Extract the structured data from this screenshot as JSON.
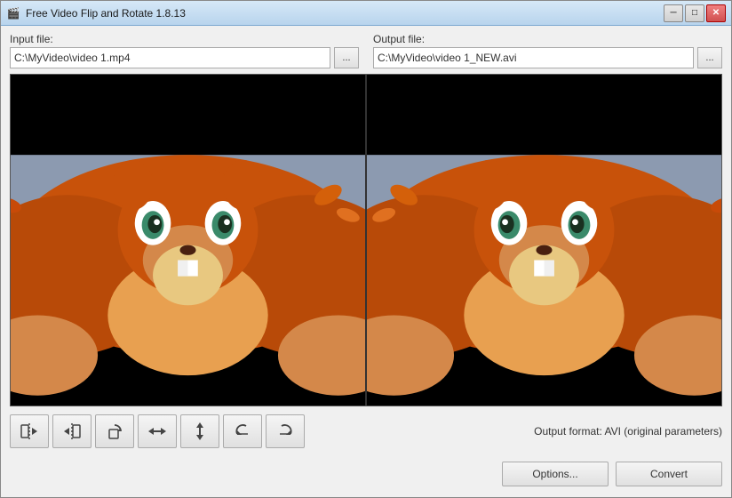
{
  "window": {
    "title": "Free Video Flip and Rotate 1.8.13",
    "icon": "🎬"
  },
  "title_buttons": {
    "minimize": "─",
    "maximize": "□",
    "close": "✕"
  },
  "input_file": {
    "label": "Input file:",
    "value": "C:\\MyVideo\\video 1.mp4",
    "browse_label": "..."
  },
  "output_file": {
    "label": "Output file:",
    "value": "C:\\MyVideo\\video 1_NEW.avi",
    "browse_label": "..."
  },
  "toolbar": {
    "buttons": [
      {
        "id": "flip-h-left",
        "tooltip": "Flip horizontal left"
      },
      {
        "id": "flip-h-right",
        "tooltip": "Flip horizontal right"
      },
      {
        "id": "rotate-cw",
        "tooltip": "Rotate clockwise"
      },
      {
        "id": "flip-horizontal",
        "tooltip": "Flip horizontal"
      },
      {
        "id": "flip-vertical",
        "tooltip": "Flip vertical"
      },
      {
        "id": "rotate-ccw-45",
        "tooltip": "Rotate CCW 45"
      },
      {
        "id": "rotate-cw-45",
        "tooltip": "Rotate CW 45"
      }
    ],
    "output_format": "Output format: AVI (original parameters)"
  },
  "bottom": {
    "options_label": "Options...",
    "convert_label": "Convert"
  }
}
